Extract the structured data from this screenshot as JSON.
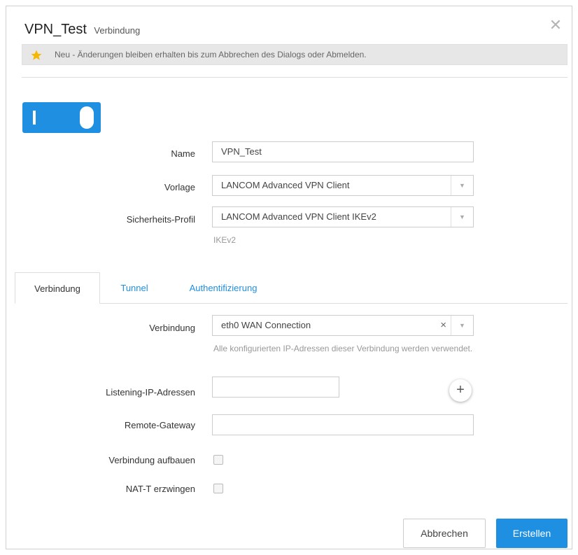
{
  "dialog": {
    "title": "VPN_Test",
    "subtitle": "Verbindung",
    "notice": "Neu - Änderungen bleiben erhalten bis zum Abbrechen des Dialogs oder Abmelden."
  },
  "toggle": {
    "state": "on"
  },
  "form": {
    "name": {
      "label": "Name",
      "value": "VPN_Test"
    },
    "vorlage": {
      "label": "Vorlage",
      "value": "LANCOM Advanced VPN Client"
    },
    "sicherheitsprofil": {
      "label": "Sicherheits-Profil",
      "value": "LANCOM Advanced VPN Client IKEv2",
      "hint": "IKEv2"
    }
  },
  "tabs": [
    {
      "label": "Verbindung",
      "active": true
    },
    {
      "label": "Tunnel",
      "active": false
    },
    {
      "label": "Authentifizierung",
      "active": false
    }
  ],
  "verbindung": {
    "connection": {
      "label": "Verbindung",
      "value": "eth0 WAN Connection",
      "hint": "Alle konfigurierten IP-Adressen dieser Verbindung werden verwendet."
    },
    "listening": {
      "label": "Listening-IP-Adressen",
      "value": ""
    },
    "remote_gateway": {
      "label": "Remote-Gateway",
      "value": ""
    },
    "aufbauen": {
      "label": "Verbindung aufbauen",
      "checked": false
    },
    "natt": {
      "label": "NAT-T erzwingen",
      "checked": false
    }
  },
  "buttons": {
    "cancel": "Abbrechen",
    "create": "Erstellen"
  },
  "icons": {
    "notice": "star-icon",
    "close": "close-icon",
    "add": "plus-icon",
    "select": "chevron-down-icon",
    "clear": "clear-icon"
  },
  "colors": {
    "accent": "#1e8fe1",
    "star": "#f5b800"
  }
}
